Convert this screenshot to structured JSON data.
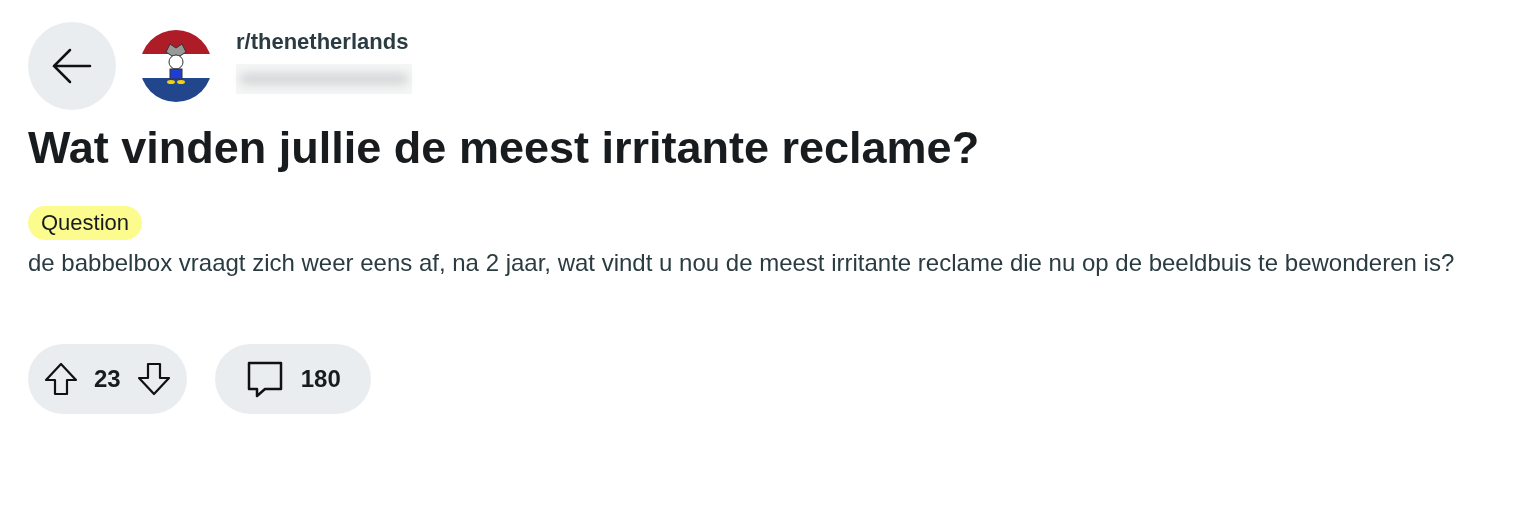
{
  "header": {
    "subreddit": "r/thenetherlands"
  },
  "post": {
    "title": "Wat vinden jullie de meest irritante reclame?",
    "flair": {
      "label": "Question",
      "color": "#fcfc8e"
    },
    "body": "de babbelbox vraagt zich weer eens af, na 2 jaar, wat vindt u nou de meest irritante reclame die nu op de beeldbuis te bewonderen is?"
  },
  "actions": {
    "votes": "23",
    "comments": "180"
  }
}
